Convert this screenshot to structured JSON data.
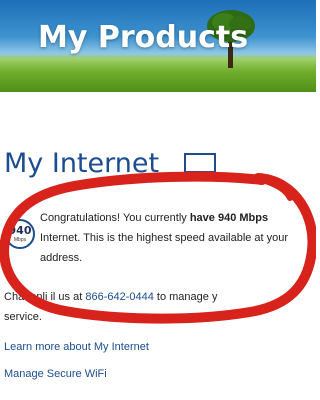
{
  "hero": {
    "title": "My Products"
  },
  "internet": {
    "title": "My Internet",
    "badge_value": "940",
    "badge_unit": "Mbps",
    "message_prefix": "Congratulations! You currently ",
    "message_strong": "have 940 Mbps",
    "message_suffix": " Internet. This is the highest speed available at your address.",
    "chat_prefix": "Chat onli",
    "chat_middle": "il us at ",
    "phone": "866-642-0444",
    "chat_suffix": " to manage y",
    "chat_end": "service."
  },
  "links": {
    "learn_more": "Learn more about My Internet",
    "manage_wifi": "Manage Secure WiFi"
  },
  "colors": {
    "brand_blue": "#1b4d8f",
    "annotation_red": "#d8231c"
  },
  "icons": {
    "section": "laptop-icon",
    "banner": "tree"
  }
}
